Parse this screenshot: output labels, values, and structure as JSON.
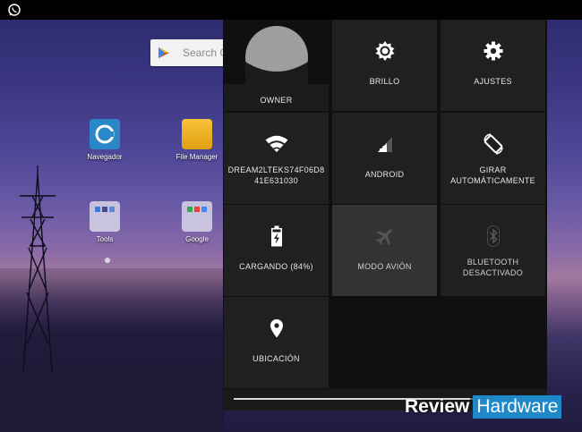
{
  "colors": {
    "panel_bg": "#101010",
    "tile_bg": "#202020",
    "tile_active_bg": "#333333",
    "watermark_accent": "#1e88c8"
  },
  "statusbar": {
    "icon": "whatsapp-icon"
  },
  "home": {
    "search_placeholder": "Search G",
    "apps": [
      {
        "label": "Navegador",
        "icon": "browser-icon"
      },
      {
        "label": "File Manager",
        "icon": "folder-icon"
      },
      {
        "label": "Tools",
        "icon": "folder-icon"
      },
      {
        "label": "Google",
        "icon": "folder-icon"
      }
    ]
  },
  "quick_settings": {
    "tiles": [
      {
        "label": "OWNER",
        "icon": "avatar-icon"
      },
      {
        "label": "BRILLO",
        "icon": "brightness-icon"
      },
      {
        "label": "AJUSTES",
        "icon": "gear-icon"
      },
      {
        "label_line1": "DREAM2LTEKS74F06D8",
        "label_line2": "41E631030",
        "icon": "wifi-icon"
      },
      {
        "label": "ANDROID",
        "icon": "signal-icon"
      },
      {
        "label_line1": "GIRAR",
        "label_line2": "AUTOMÁTICAMENTE",
        "icon": "rotate-icon"
      },
      {
        "label": "CARGANDO (84%)",
        "icon": "battery-charging-icon"
      },
      {
        "label": "MODO AVIÓN",
        "icon": "airplane-icon"
      },
      {
        "label_line1": "BLUETOOTH",
        "label_line2": "DESACTIVADO",
        "icon": "bluetooth-icon"
      },
      {
        "label": "UBICACIÓN",
        "icon": "location-icon"
      }
    ],
    "brightness_level": 0.78
  },
  "watermark": {
    "part1": "Review",
    "part2": "Hardware"
  }
}
